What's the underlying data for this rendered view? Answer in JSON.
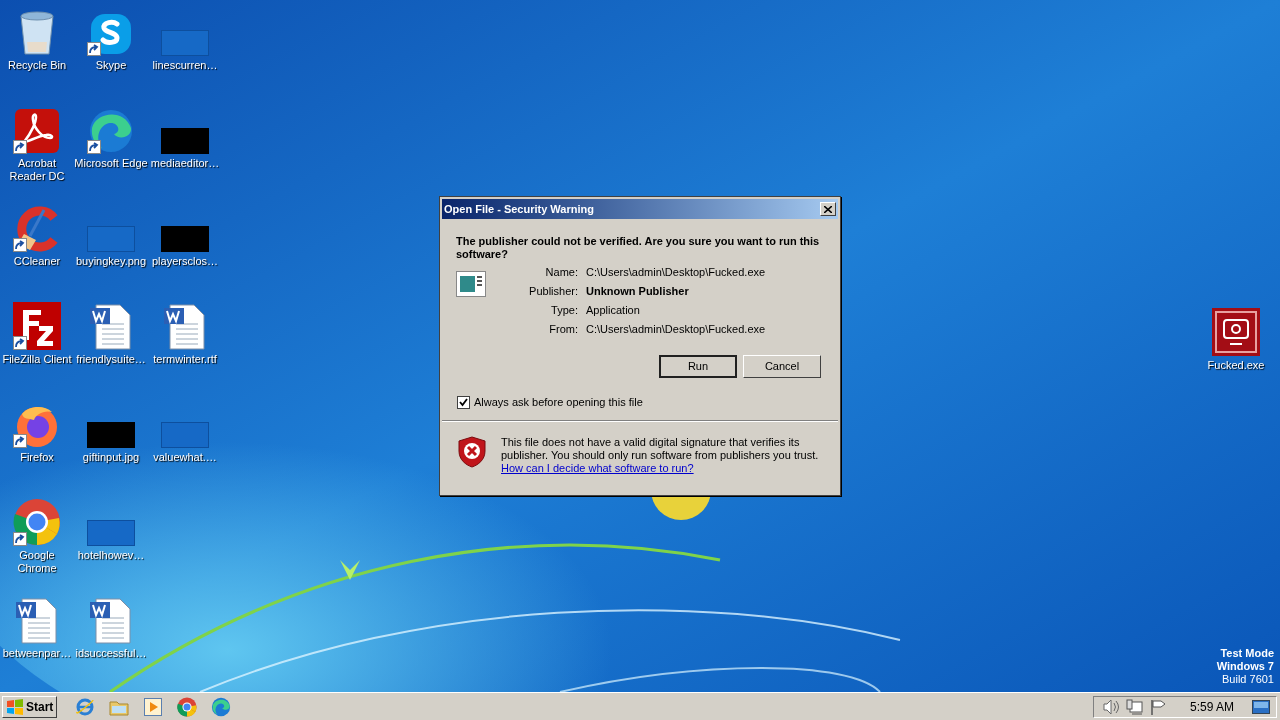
{
  "desktop": {
    "columns": [
      {
        "icons": [
          {
            "label": "Recycle Bin",
            "kind": "recycle",
            "shortcut": false
          },
          {
            "label": "Acrobat Reader DC",
            "kind": "acrobat",
            "shortcut": true
          },
          {
            "label": "CCleaner",
            "kind": "ccleaner",
            "shortcut": true
          },
          {
            "label": "FileZilla Client",
            "kind": "filezilla",
            "shortcut": true
          },
          {
            "label": "Firefox",
            "kind": "firefox",
            "shortcut": true
          },
          {
            "label": "Google Chrome",
            "kind": "chrome",
            "shortcut": true
          },
          {
            "label": "betweenpar…",
            "kind": "word",
            "shortcut": false
          }
        ]
      },
      {
        "icons": [
          {
            "label": "Skype",
            "kind": "skype",
            "shortcut": true
          },
          {
            "label": "Microsoft Edge",
            "kind": "edge",
            "shortcut": true
          },
          {
            "label": "buyingkey.png",
            "kind": "blank-image",
            "shortcut": false
          },
          {
            "label": "friendlysuite…",
            "kind": "word",
            "shortcut": false
          },
          {
            "label": "giftinput.jpg",
            "kind": "dark-image",
            "shortcut": false
          },
          {
            "label": "hotelhowev…",
            "kind": "blank-image",
            "shortcut": false
          },
          {
            "label": "idsuccessful…",
            "kind": "word",
            "shortcut": false
          }
        ]
      },
      {
        "icons": [
          {
            "label": "linescurren…",
            "kind": "blank-image",
            "shortcut": false
          },
          {
            "label": "mediaeditor…",
            "kind": "dark-image",
            "shortcut": false
          },
          {
            "label": "playersclos…",
            "kind": "dark-image",
            "shortcut": false
          },
          {
            "label": "termwinter.rtf",
            "kind": "word",
            "shortcut": false
          },
          {
            "label": "valuewhat.…",
            "kind": "blank-image",
            "shortcut": false
          }
        ]
      }
    ],
    "right_icon": {
      "label": "Fucked.exe",
      "kind": "exe",
      "shortcut": false
    }
  },
  "dialog": {
    "title": "Open File - Security Warning",
    "heading": "The publisher could not be verified.  Are you sure you want to run this software?",
    "fields": [
      {
        "label": "Name:",
        "value": "C:\\Users\\admin\\Desktop\\Fucked.exe",
        "bold": false
      },
      {
        "label": "Publisher:",
        "value": "Unknown Publisher",
        "bold": true
      },
      {
        "label": "Type:",
        "value": "Application",
        "bold": false
      },
      {
        "label": "From:",
        "value": "C:\\Users\\admin\\Desktop\\Fucked.exe",
        "bold": false
      }
    ],
    "buttons": [
      {
        "label": "Run",
        "default": true
      },
      {
        "label": "Cancel",
        "default": false
      }
    ],
    "checkbox": {
      "label": "Always ask before opening this file",
      "checked": true
    },
    "footer_text": "This file does not have a valid digital signature that verifies its publisher.  You should only run software from publishers you trust.",
    "footer_link": "How can I decide what software to run?"
  },
  "watermark_lines": [
    "Test Mode",
    "Windows 7",
    "Build 7601"
  ],
  "taskbar": {
    "start": "Start",
    "pinned": [
      {
        "kind": "ie"
      },
      {
        "kind": "explorer"
      },
      {
        "kind": "media"
      },
      {
        "kind": "chrome"
      },
      {
        "kind": "edge"
      }
    ],
    "tray": [
      {
        "kind": "volume"
      },
      {
        "kind": "network"
      },
      {
        "kind": "flag"
      }
    ],
    "clock": "5:59 AM"
  }
}
